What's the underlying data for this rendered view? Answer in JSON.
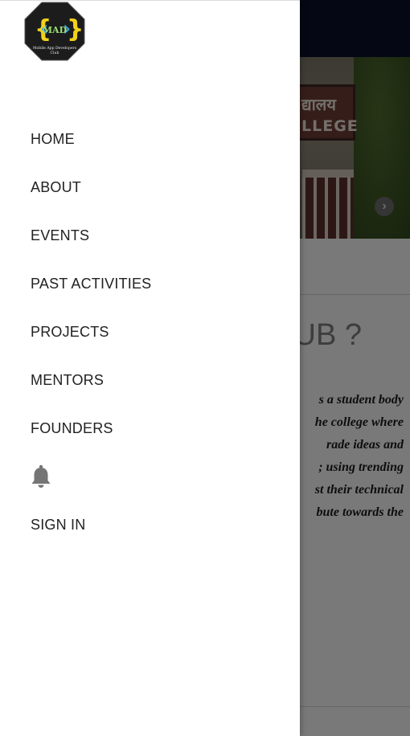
{
  "background": {
    "hero": {
      "sign_line1": "द्यालय",
      "sign_line2": "LLEGE"
    },
    "heading": "UB ?",
    "paragraph_lines": [
      "s a student body",
      "he college where",
      "rade  ideas  and",
      ";  using  trending",
      "st their technical",
      "bute  towards  the"
    ]
  },
  "drawer": {
    "logo": {
      "text": "MAD",
      "caption_line1": "Mobile App Developers",
      "caption_line2": "Club"
    },
    "nav": {
      "home": "HOME",
      "about": "ABOUT",
      "events": "EVENTS",
      "past_activities": "PAST ACTIVITIES",
      "projects": "PROJECTS",
      "mentors": "MENTORS",
      "founders": "FOUNDERS",
      "sign_in": "SIGN IN"
    },
    "icons": {
      "bell": "bell-icon",
      "next": "chevron-right-icon"
    }
  },
  "colors": {
    "drawer_bg": "#ffffff",
    "nav_text": "#222222",
    "topbar": "#0b0f2a",
    "logo_bg": "#1c1c1c",
    "logo_brace_yellow": "#f2d21a",
    "logo_brace_blue": "#3fa8e8"
  }
}
